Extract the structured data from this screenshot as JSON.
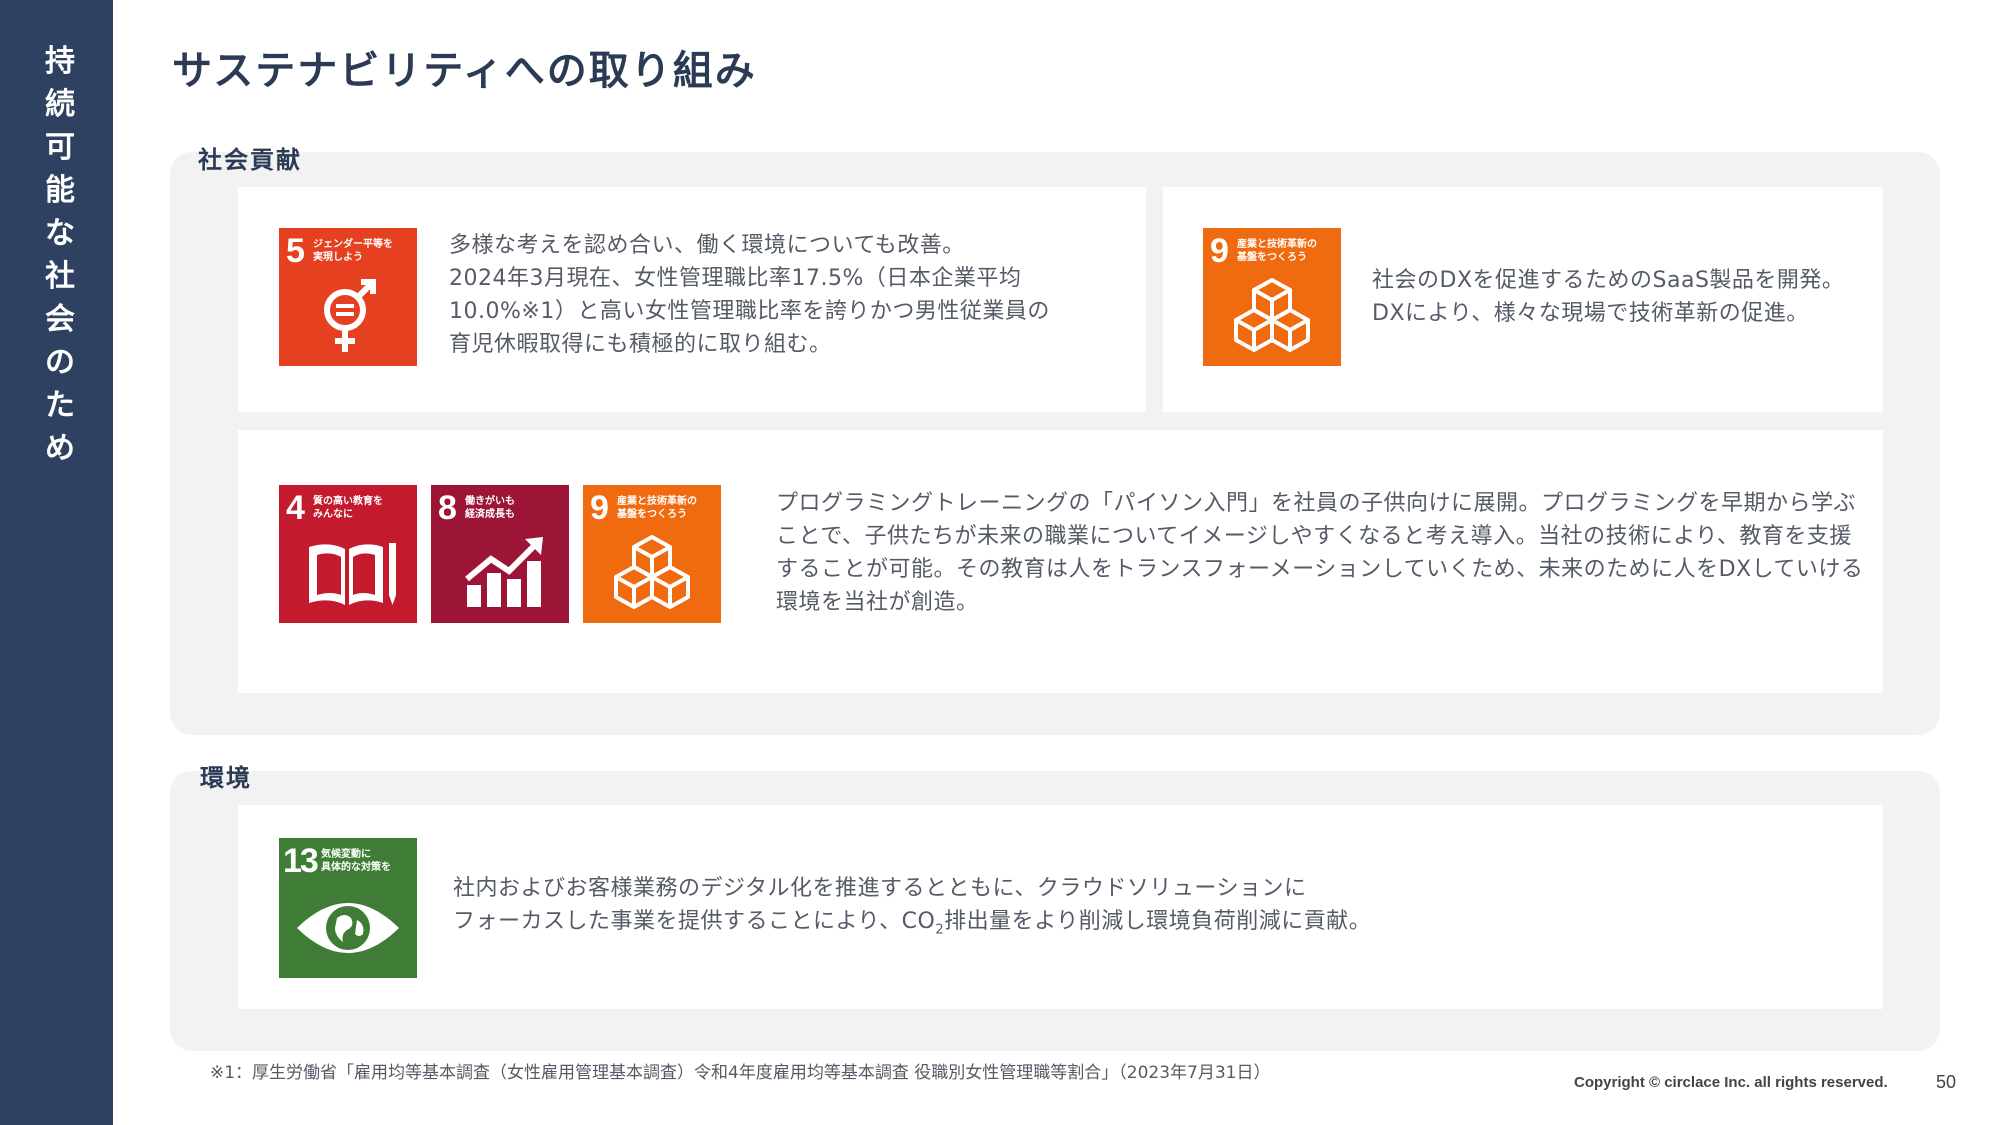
{
  "sidebar": {
    "title": "持続可能な社会のため"
  },
  "page": {
    "title": "サステナビリティへの取り組み",
    "number": "50"
  },
  "social": {
    "label": "社会貢献",
    "gender": {
      "text": "多様な考えを認め合い、働く環境についても改善。\n2024年3月現在、女性管理職比率17.5%（日本企業平均\n10.0%※1）と高い女性管理職比率を誇りかつ男性従業員の\n育児休暇取得にも積極的に取り組む。"
    },
    "dx": {
      "text": "社会のDXを促進するためのSaaS製品を開発。\nDXにより、様々な現場で技術革新の促進。"
    },
    "education": {
      "text": "プログラミングトレーニングの「パイソン入門」を社員の子供向けに展開。プログラミングを早期から学ぶことで、子供たちが未来の職業についてイメージしやすくなると考え導入。当社の技術により、教育を支援することが可能。その教育は人をトランスフォーメーションしていくため、未来のために人をDXしていける環境を当社が創造。"
    }
  },
  "environment": {
    "label": "環境",
    "line1": "社内およびお客様業務のデジタル化を推進するとともに、クラウドソリューションに",
    "line2_before": "フォーカスした事業を提供することにより、CO",
    "line2_sub": "2",
    "line2_after": "排出量をより削減し環境負荷削減に貢献。"
  },
  "sdgs": {
    "goal5": {
      "number": "5",
      "label": "ジェンダー平等を\n実現しよう",
      "color": "#e5401f"
    },
    "goal9": {
      "number": "9",
      "label": "産業と技術革新の\n基盤をつくろう",
      "color": "#f06a0f"
    },
    "goal4": {
      "number": "4",
      "label": "質の高い教育を\nみんなに",
      "color": "#c41a2e"
    },
    "goal8": {
      "number": "8",
      "label": "働きがいも\n経済成長も",
      "color": "#9c1537"
    },
    "goal13": {
      "number": "13",
      "label": "気候変動に\n具体的な対策を",
      "color": "#3f7d36"
    }
  },
  "footer": {
    "footnote": "※1：厚生労働省「雇用均等基本調査（女性雇用管理基本調査）令和4年度雇用均等基本調査 役職別女性管理職等割合」（2023年7月31日）",
    "copyright": "Copyright © circlace Inc. all rights reserved."
  }
}
